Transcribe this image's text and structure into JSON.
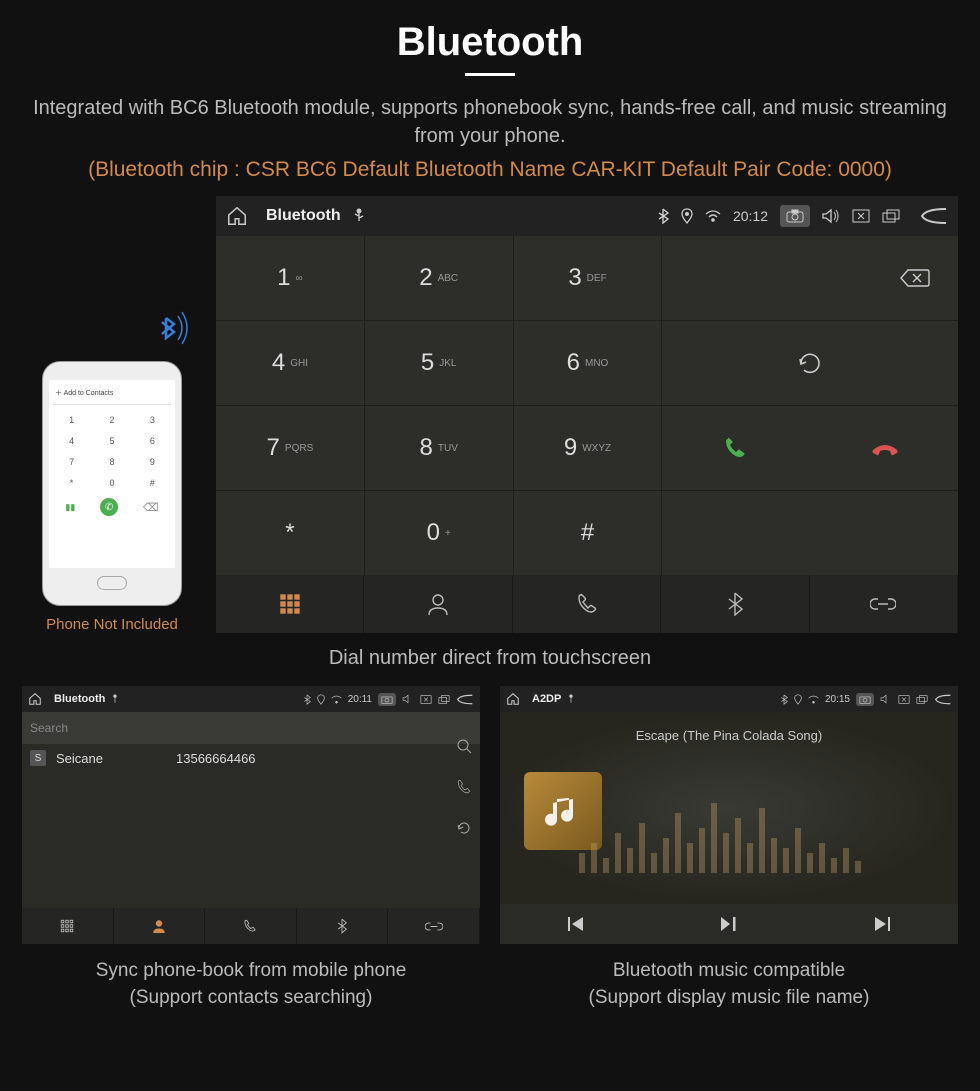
{
  "title": "Bluetooth",
  "description": "Integrated with BC6 Bluetooth module, supports phonebook sync, hands-free call, and music streaming from your phone.",
  "spec_line": "(Bluetooth chip : CSR BC6     Default Bluetooth Name CAR-KIT     Default Pair Code: 0000)",
  "phone_not_included": "Phone Not Included",
  "phone_mock": {
    "add_contacts": "Add to Contacts",
    "keys": [
      "1",
      "2",
      "3",
      "4",
      "5",
      "6",
      "7",
      "8",
      "9",
      "*",
      "0",
      "#"
    ]
  },
  "dialer": {
    "statusbar": {
      "title": "Bluetooth",
      "time": "20:12"
    },
    "keys": [
      {
        "num": "1",
        "sub": "∞"
      },
      {
        "num": "2",
        "sub": "ABC"
      },
      {
        "num": "3",
        "sub": "DEF"
      },
      {
        "num": "4",
        "sub": "GHI"
      },
      {
        "num": "5",
        "sub": "JKL"
      },
      {
        "num": "6",
        "sub": "MNO"
      },
      {
        "num": "7",
        "sub": "PQRS"
      },
      {
        "num": "8",
        "sub": "TUV"
      },
      {
        "num": "9",
        "sub": "WXYZ"
      },
      {
        "num": "*",
        "sub": ""
      },
      {
        "num": "0",
        "sub": "+"
      },
      {
        "num": "#",
        "sub": ""
      }
    ]
  },
  "dialer_caption": "Dial number direct from touchscreen",
  "phonebook": {
    "statusbar": {
      "title": "Bluetooth",
      "time": "20:11"
    },
    "search_placeholder": "Search",
    "contact_name": "Seicane",
    "contact_number": "13566664466"
  },
  "phonebook_caption_line1": "Sync phone-book from mobile phone",
  "phonebook_caption_line2": "(Support contacts searching)",
  "music": {
    "statusbar": {
      "title": "A2DP",
      "time": "20:15"
    },
    "song": "Escape (The Pina Colada Song)"
  },
  "music_caption_line1": "Bluetooth music compatible",
  "music_caption_line2": "(Support display music file name)"
}
